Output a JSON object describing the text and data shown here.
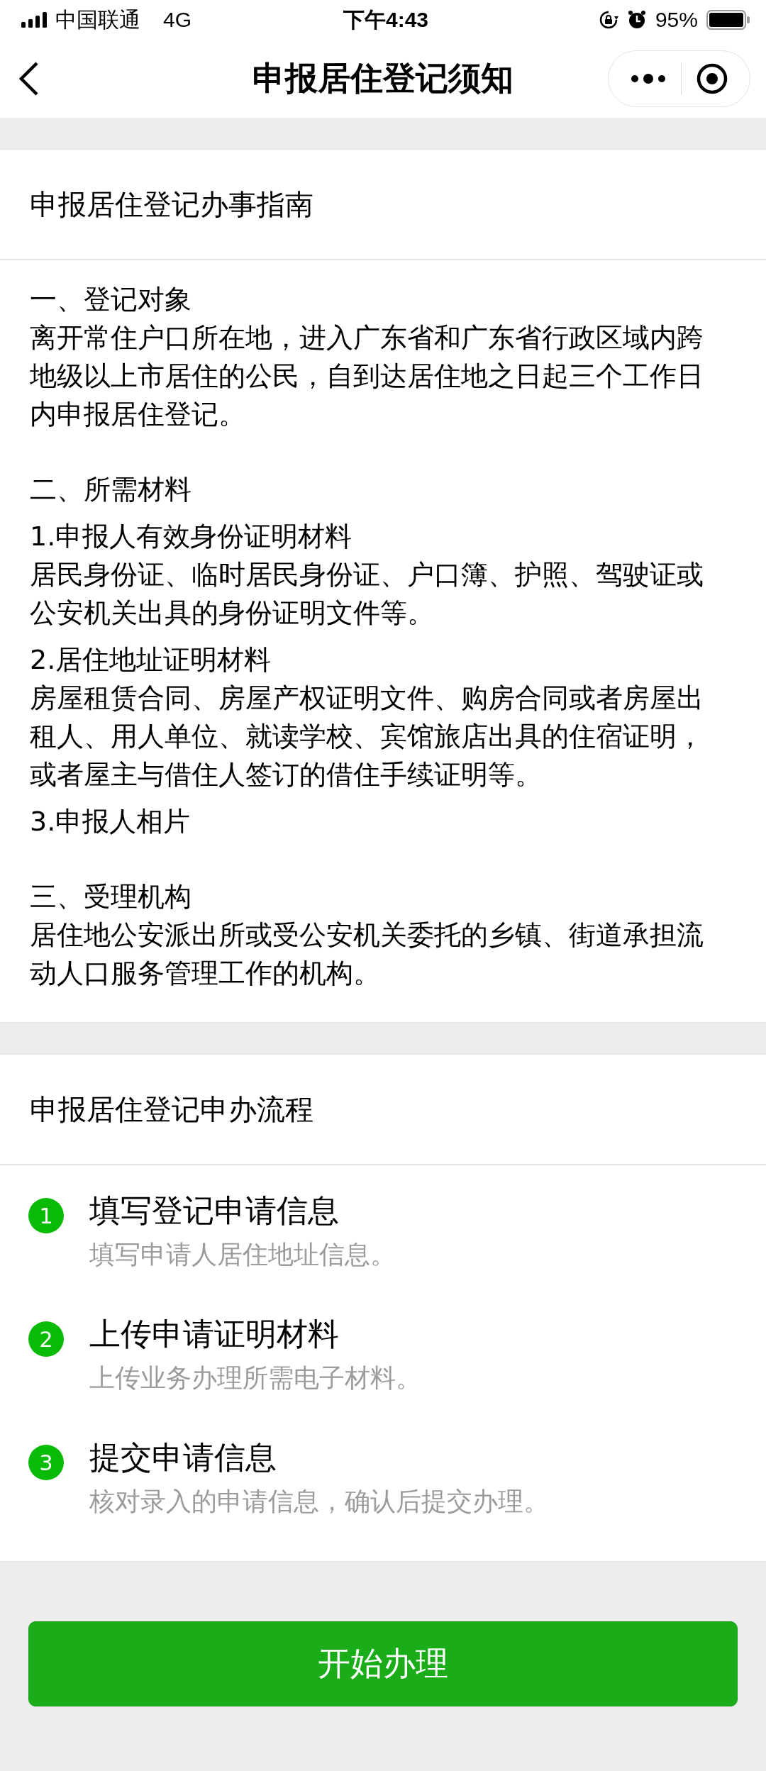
{
  "status_bar": {
    "carrier": "中国联通",
    "network": "4G",
    "time": "下午4:43",
    "battery": "95%"
  },
  "nav_bar": {
    "title": "申报居住登记须知"
  },
  "guide": {
    "title": "申报居住登记办事指南",
    "sections": [
      {
        "lines": [
          {
            "kind": "heading",
            "text": "一、登记对象"
          },
          {
            "kind": "paragraph",
            "text": "离开常住户口所在地，进入广东省和广东省行政区域内跨地级以上市居住的公民，自到达居住地之日起三个工作日内申报居住登记。"
          }
        ]
      },
      {
        "lines": [
          {
            "kind": "heading",
            "text": "二、所需材料"
          },
          {
            "kind": "subheading",
            "text": "1.申报人有效身份证明材料"
          },
          {
            "kind": "paragraph",
            "text": "居民身份证、临时居民身份证、户口簿、护照、驾驶证或公安机关出具的身份证明文件等。"
          },
          {
            "kind": "subheading",
            "text": "2.居住地址证明材料"
          },
          {
            "kind": "paragraph",
            "text": "房屋租赁合同、房屋产权证明文件、购房合同或者房屋出租人、用人单位、就读学校、宾馆旅店出具的住宿证明，或者屋主与借住人签订的借住手续证明等。"
          },
          {
            "kind": "subheading",
            "text": "3.申报人相片"
          }
        ]
      },
      {
        "lines": [
          {
            "kind": "heading",
            "text": "三、受理机构"
          },
          {
            "kind": "paragraph",
            "text": "居住地公安派出所或受公安机关委托的乡镇、街道承担流动人口服务管理工作的机构。"
          }
        ]
      }
    ]
  },
  "process": {
    "title": "申报居住登记申办流程",
    "steps": [
      {
        "number": "1",
        "title": "填写登记申请信息",
        "description": "填写申请人居住地址信息。"
      },
      {
        "number": "2",
        "title": "上传申请证明材料",
        "description": "上传业务办理所需电子材料。"
      },
      {
        "number": "3",
        "title": "提交申请信息",
        "description": "核对录入的申请信息，确认后提交办理。"
      }
    ]
  },
  "start_button": "开始办理"
}
